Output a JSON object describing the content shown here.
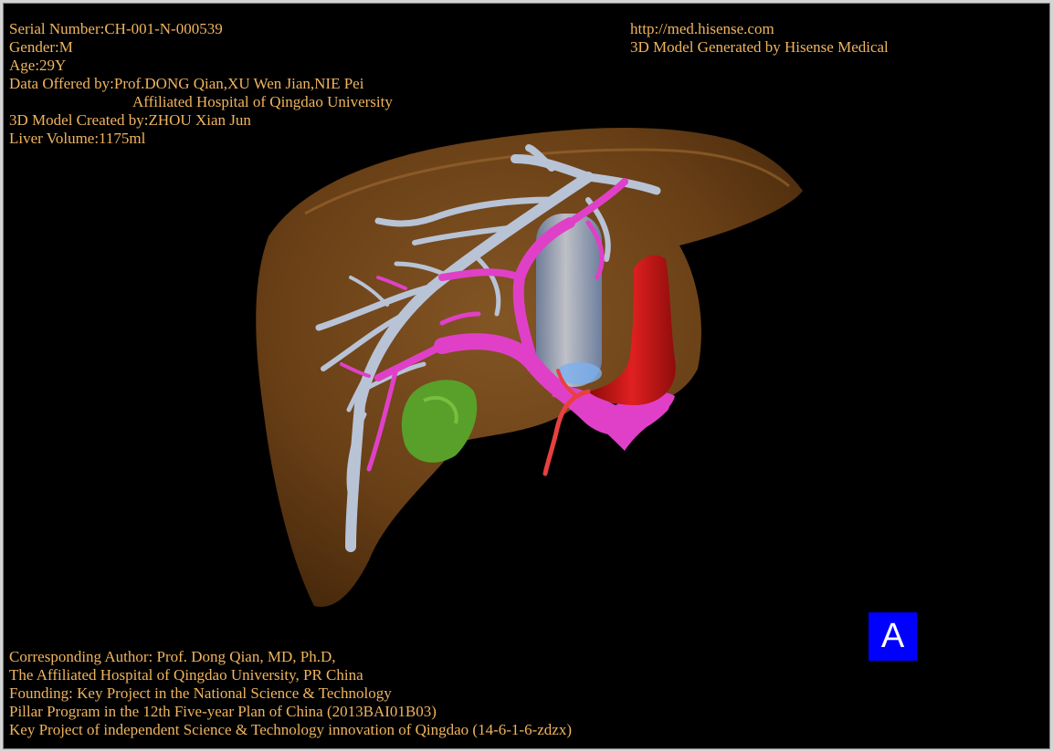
{
  "header_left": {
    "serial": "Serial Number:CH-001-N-000539",
    "gender": "Gender:M",
    "age": "Age:29Y",
    "data_offered": "Data Offered by:Prof.DONG Qian,XU Wen Jian,NIE Pei",
    "hospital": "Affiliated Hospital of Qingdao University",
    "model_created": "3D Model Created by:ZHOU Xian Jun",
    "liver_volume": "Liver Volume:1175ml"
  },
  "header_right": {
    "url": "http://med.hisense.com",
    "generator": "3D Model Generated by Hisense Medical"
  },
  "footer": {
    "line1": "Corresponding Author: Prof. Dong Qian, MD, Ph.D,",
    "line2": "The Affiliated Hospital of Qingdao University, PR China",
    "line3": "Founding: Key Project in the National Science & Technology",
    "line4": "Pillar Program in the 12th Five-year Plan of China (2013BAI01B03)",
    "line5": "Key Project of independent Science & Technology innovation of Qingdao (14-6-1-6-zdzx)"
  },
  "panel_label": "A",
  "colors": {
    "text": "#f0b45e",
    "liver": "#7a4a1c",
    "hepatic_vein": "#b8c3d6",
    "portal_vein": "#e040c8",
    "artery": "#d01818",
    "ivc": "#a8c8f0",
    "lesion": "#58a02a",
    "badge": "#0000ff"
  }
}
